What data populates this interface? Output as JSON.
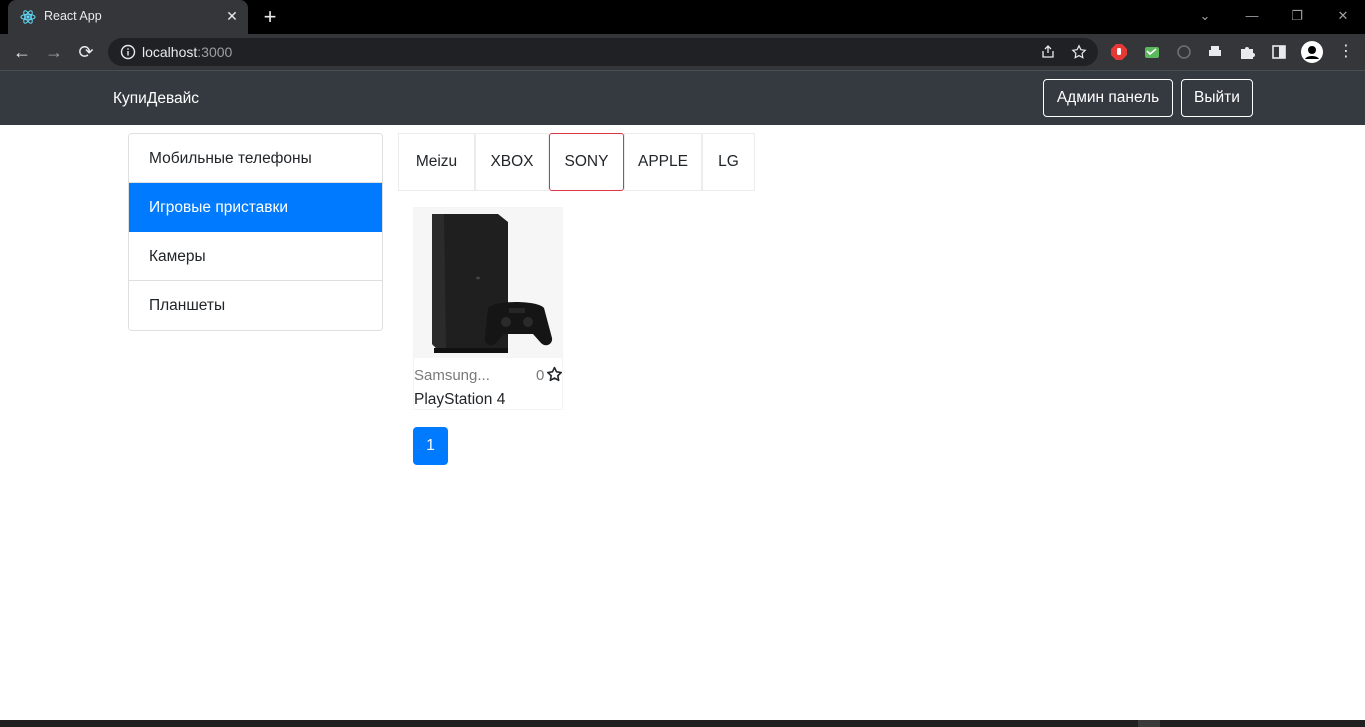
{
  "browser": {
    "tab_title": "React App",
    "url_host": "localhost",
    "url_port": ":3000"
  },
  "navbar": {
    "brand": "КупиДевайс",
    "admin_button": "Админ панель",
    "logout_button": "Выйти"
  },
  "types": {
    "items": [
      {
        "label": "Мобильные телефоны",
        "active": false
      },
      {
        "label": "Игровые приставки",
        "active": true
      },
      {
        "label": "Камеры",
        "active": false
      },
      {
        "label": "Планшеты",
        "active": false
      }
    ]
  },
  "brands": {
    "items": [
      {
        "label": "Meizu",
        "active": false
      },
      {
        "label": "XBOX",
        "active": false
      },
      {
        "label": "SONY",
        "active": true
      },
      {
        "label": "APPLE",
        "active": false
      },
      {
        "label": "LG",
        "active": false
      }
    ]
  },
  "devices": [
    {
      "brand": "Samsung...",
      "rating": "0",
      "name": "PlayStation 4"
    }
  ],
  "pagination": {
    "pages": [
      "1"
    ],
    "current": "1"
  },
  "colors": {
    "primary": "#007bff",
    "navbar_bg": "#343a40",
    "active_brand_border": "#dc3545"
  }
}
